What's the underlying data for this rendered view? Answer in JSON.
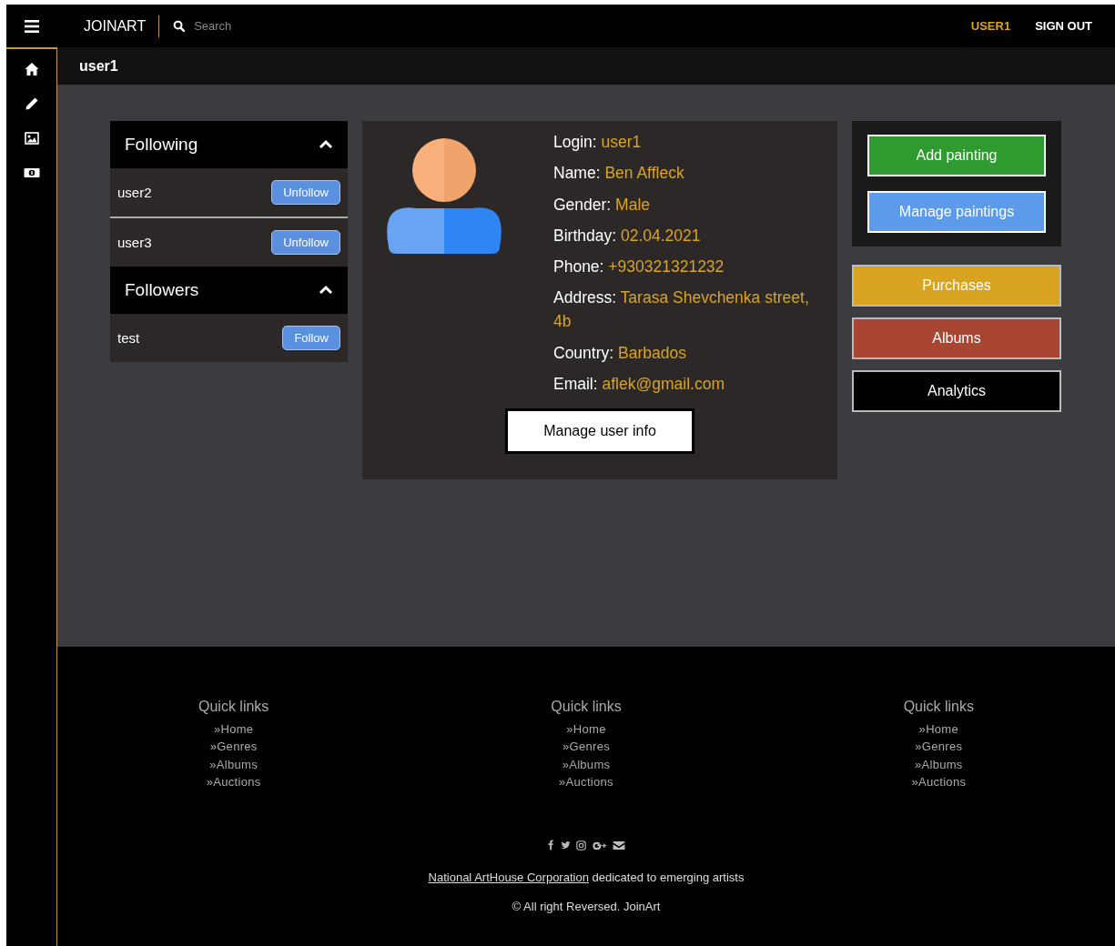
{
  "topbar": {
    "brand": "JOINART",
    "search": {
      "placeholder": "Search"
    },
    "user": "USER1",
    "sign_out": "SIGN OUT"
  },
  "page_title": "user1",
  "follow_panel": {
    "sections": [
      {
        "title": "Following",
        "expanded": true,
        "items": [
          {
            "name": "user2",
            "action": "Unfollow"
          },
          {
            "name": "user3",
            "action": "Unfollow"
          }
        ]
      },
      {
        "title": "Followers",
        "expanded": true,
        "items": [
          {
            "name": "test",
            "action": "Follow"
          }
        ]
      }
    ]
  },
  "profile": {
    "fields": [
      {
        "label": "Login:",
        "value": "user1"
      },
      {
        "label": "Name:",
        "value": "Ben Affleck"
      },
      {
        "label": "Gender:",
        "value": "Male"
      },
      {
        "label": "Birthday:",
        "value": "02.04.2021"
      },
      {
        "label": "Phone:",
        "value": "+930321321232"
      },
      {
        "label": "Address:",
        "value": "Tarasa Shevchenka street, 4b"
      },
      {
        "label": "Country:",
        "value": "Barbados"
      },
      {
        "label": "Email:",
        "value": "aflek@gmail.com"
      }
    ],
    "manage_button": "Manage user info"
  },
  "actions": {
    "painting_buttons": [
      {
        "label": "Add painting",
        "color": "#2e9a30"
      },
      {
        "label": "Manage paintings",
        "color": "#5c9bea"
      }
    ],
    "buttons": [
      {
        "label": "Purchases",
        "color": "#d9a521"
      },
      {
        "label": "Albums",
        "color": "#a84533"
      },
      {
        "label": "Analytics",
        "color": "#000000"
      }
    ]
  },
  "footer": {
    "columns": [
      {
        "title": "Quick links",
        "links": [
          "»Home",
          "»Genres",
          "»Albums",
          "»Auctions"
        ]
      },
      {
        "title": "Quick links",
        "links": [
          "»Home",
          "»Genres",
          "»Albums",
          "»Auctions"
        ]
      },
      {
        "title": "Quick links",
        "links": [
          "»Home",
          "»Genres",
          "»Albums",
          "»Auctions"
        ]
      }
    ],
    "credit_link": "National ArtHouse Corporation",
    "credit_text": "dedicated to emerging artists",
    "copyright": "© All right Reversed.  JoinArt"
  }
}
